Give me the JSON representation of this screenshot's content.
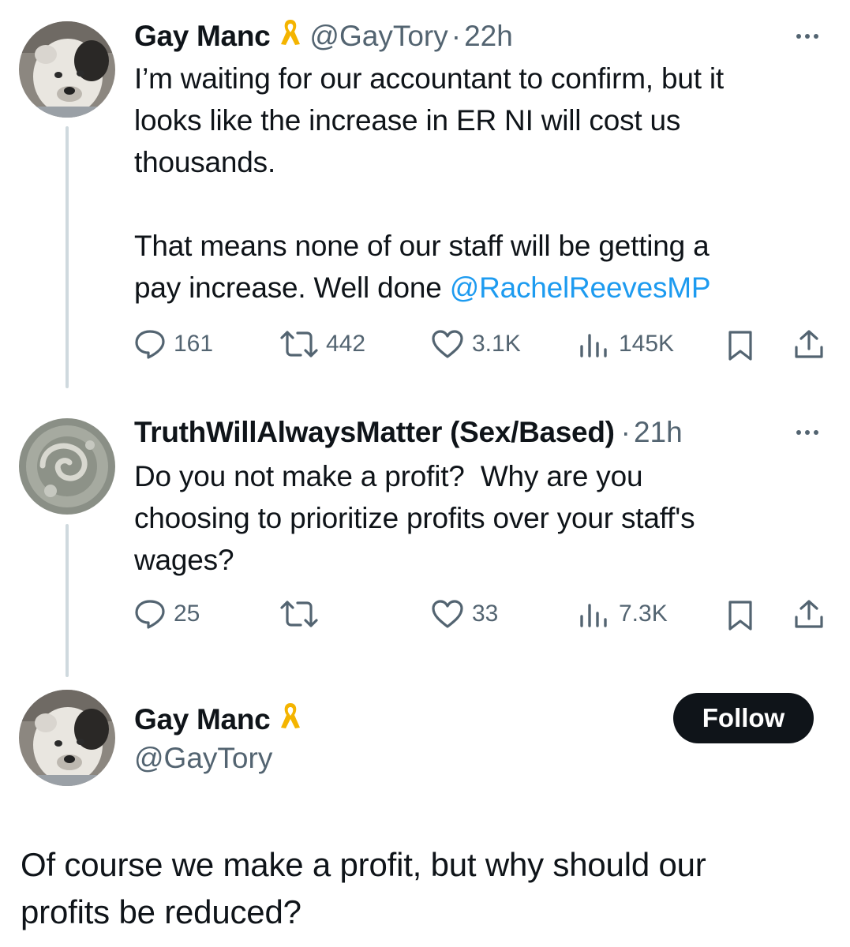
{
  "tweet1": {
    "display_name": "Gay Manc",
    "badge_icon": "yellow-ribbon-icon",
    "handle": "@GayTory",
    "separator": "·",
    "time": "22h",
    "text_line1": "I’m waiting for our accountant to confirm, but it",
    "text_line2": "looks like the increase in ER NI will cost us",
    "text_line3": "thousands.",
    "text_line4": "That means none of our staff will be getting a",
    "text_line5_prefix": "pay increase. Well done ",
    "mention": "@RachelReevesMP",
    "replies": "161",
    "reposts": "442",
    "likes": "3.1K",
    "views": "145K"
  },
  "tweet2": {
    "display_name": "TruthWillAlwaysMatter (Sex/Based)",
    "separator": "·",
    "time": "21h",
    "text_line1": "Do you not make a profit?  Why are you",
    "text_line2": "choosing to prioritize profits over your staff's",
    "text_line3": "wages?",
    "replies": "25",
    "reposts": "",
    "likes": "33",
    "views": "7.3K"
  },
  "main_tweet": {
    "display_name": "Gay Manc",
    "handle": "@GayTory",
    "follow_label": "Follow",
    "text_line1": "Of course we make a profit, but why should our",
    "text_line2": "profits be reduced?"
  },
  "colors": {
    "text": "#0f1419",
    "muted": "#536471",
    "link": "#1d9bf0",
    "ribbon": "#f4b400",
    "thread_line": "#cfd9de"
  }
}
